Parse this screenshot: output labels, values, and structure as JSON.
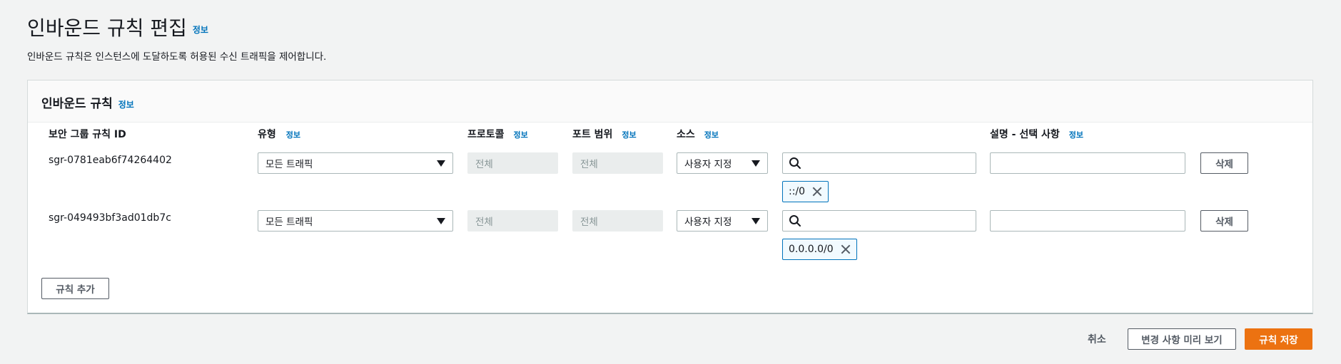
{
  "page": {
    "title": "인바운드 규칙 편집",
    "info": "정보",
    "description": "인바운드 규칙은 인스턴스에 도달하도록 허용된 수신 트래픽을 제어합니다."
  },
  "panel": {
    "title": "인바운드 규칙",
    "info": "정보",
    "columns": {
      "rule_id": "보안 그룹 규칙 ID",
      "type": "유형",
      "protocol": "프로토콜",
      "port_range": "포트 범위",
      "source": "소스",
      "description": "설명 - 선택 사항",
      "info": "정보"
    },
    "rules": [
      {
        "id": "sgr-0781eab6f74264402",
        "type": "모든 트래픽",
        "protocol": "전체",
        "port_range": "전체",
        "source_type": "사용자 지정",
        "source_search": "",
        "source_token": "::/0",
        "description": "",
        "delete_label": "삭제"
      },
      {
        "id": "sgr-049493bf3ad01db7c",
        "type": "모든 트래픽",
        "protocol": "전체",
        "port_range": "전체",
        "source_type": "사용자 지정",
        "source_search": "",
        "source_token": "0.0.0.0/0",
        "description": "",
        "delete_label": "삭제"
      }
    ],
    "add_rule_label": "규칙 추가"
  },
  "footer": {
    "cancel_label": "취소",
    "preview_label": "변경 사항 미리 보기",
    "save_label": "규칙 저장"
  },
  "colors": {
    "accent": "#0073bb",
    "primary_button": "#ec7211",
    "background": "#f2f3f3"
  }
}
